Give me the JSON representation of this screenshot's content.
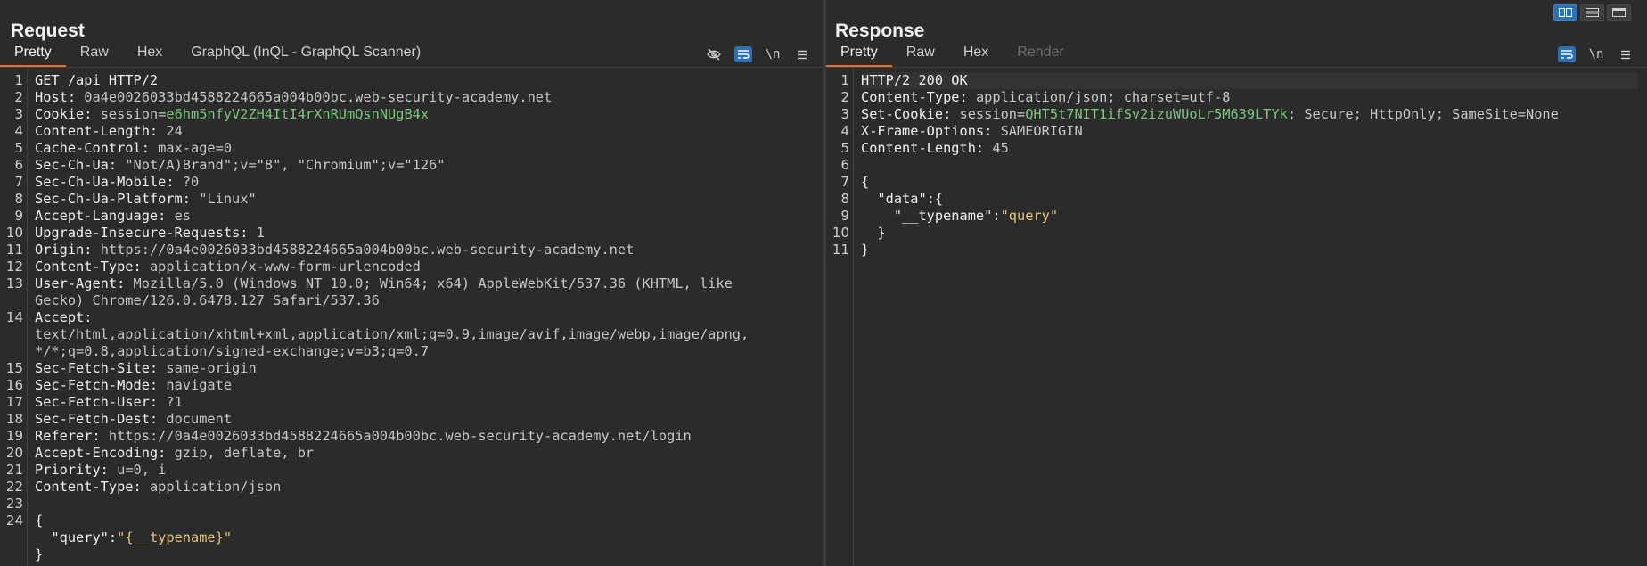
{
  "request": {
    "title": "Request",
    "tabs": [
      "Pretty",
      "Raw",
      "Hex",
      "GraphQL (InQL - GraphQL Scanner)"
    ],
    "lines": [
      {
        "n": "1",
        "parts": [
          {
            "t": "GET /api HTTP/2",
            "c": "k"
          }
        ]
      },
      {
        "n": "2",
        "parts": [
          {
            "t": "Host: ",
            "c": "k"
          },
          {
            "t": "0a4e0026033bd4588224665a004b00bc.web-security-academy.net",
            "c": "v"
          }
        ]
      },
      {
        "n": "3",
        "parts": [
          {
            "t": "Cookie: ",
            "c": "k"
          },
          {
            "t": "session",
            "c": "v"
          },
          {
            "t": "=",
            "c": "v"
          },
          {
            "t": "e6hm5nfyV2ZH4ItI4rXnRUmQsnNUgB4x",
            "c": "h"
          }
        ]
      },
      {
        "n": "4",
        "parts": [
          {
            "t": "Content-Length: ",
            "c": "k"
          },
          {
            "t": "24",
            "c": "v"
          }
        ]
      },
      {
        "n": "5",
        "parts": [
          {
            "t": "Cache-Control: ",
            "c": "k"
          },
          {
            "t": "max-age=0",
            "c": "v"
          }
        ]
      },
      {
        "n": "6",
        "parts": [
          {
            "t": "Sec-Ch-Ua: ",
            "c": "k"
          },
          {
            "t": "\"Not/A)Brand\";v=\"8\", \"Chromium\";v=\"126\"",
            "c": "v"
          }
        ]
      },
      {
        "n": "7",
        "parts": [
          {
            "t": "Sec-Ch-Ua-Mobile: ",
            "c": "k"
          },
          {
            "t": "?0",
            "c": "v"
          }
        ]
      },
      {
        "n": "8",
        "parts": [
          {
            "t": "Sec-Ch-Ua-Platform: ",
            "c": "k"
          },
          {
            "t": "\"Linux\"",
            "c": "v"
          }
        ]
      },
      {
        "n": "9",
        "parts": [
          {
            "t": "Accept-Language: ",
            "c": "k"
          },
          {
            "t": "es",
            "c": "v"
          }
        ]
      },
      {
        "n": "10",
        "parts": [
          {
            "t": "Upgrade-Insecure-Requests: ",
            "c": "k"
          },
          {
            "t": "1",
            "c": "v"
          }
        ]
      },
      {
        "n": "11",
        "parts": [
          {
            "t": "Origin: ",
            "c": "k"
          },
          {
            "t": "https://0a4e0026033bd4588224665a004b00bc.web-security-academy.net",
            "c": "v"
          }
        ]
      },
      {
        "n": "12",
        "parts": [
          {
            "t": "Content-Type: ",
            "c": "k"
          },
          {
            "t": "application/x-www-form-urlencoded",
            "c": "v"
          }
        ]
      },
      {
        "n": "13",
        "parts": [
          {
            "t": "User-Agent: ",
            "c": "k"
          },
          {
            "t": "Mozilla/5.0 (Windows NT 10.0; Win64; x64) AppleWebKit/537.36 (KHTML, like",
            "c": "v"
          }
        ]
      },
      {
        "n": "",
        "parts": [
          {
            "t": "Gecko) Chrome/126.0.6478.127 Safari/537.36",
            "c": "v"
          }
        ]
      },
      {
        "n": "14",
        "parts": [
          {
            "t": "Accept: ",
            "c": "k"
          }
        ]
      },
      {
        "n": "",
        "parts": [
          {
            "t": "text/html,application/xhtml+xml,application/xml;q=0.9,image/avif,image/webp,image/apng,",
            "c": "v"
          }
        ]
      },
      {
        "n": "",
        "parts": [
          {
            "t": "*/*;q=0.8,application/signed-exchange;v=b3;q=0.7",
            "c": "v"
          }
        ]
      },
      {
        "n": "15",
        "parts": [
          {
            "t": "Sec-Fetch-Site: ",
            "c": "k"
          },
          {
            "t": "same-origin",
            "c": "v"
          }
        ]
      },
      {
        "n": "16",
        "parts": [
          {
            "t": "Sec-Fetch-Mode: ",
            "c": "k"
          },
          {
            "t": "navigate",
            "c": "v"
          }
        ]
      },
      {
        "n": "17",
        "parts": [
          {
            "t": "Sec-Fetch-User: ",
            "c": "k"
          },
          {
            "t": "?1",
            "c": "v"
          }
        ]
      },
      {
        "n": "18",
        "parts": [
          {
            "t": "Sec-Fetch-Dest: ",
            "c": "k"
          },
          {
            "t": "document",
            "c": "v"
          }
        ]
      },
      {
        "n": "19",
        "parts": [
          {
            "t": "Referer: ",
            "c": "k"
          },
          {
            "t": "https://0a4e0026033bd4588224665a004b00bc.web-security-academy.net/login",
            "c": "v"
          }
        ]
      },
      {
        "n": "20",
        "parts": [
          {
            "t": "Accept-Encoding: ",
            "c": "k"
          },
          {
            "t": "gzip, deflate, br",
            "c": "v"
          }
        ]
      },
      {
        "n": "21",
        "parts": [
          {
            "t": "Priority: ",
            "c": "k"
          },
          {
            "t": "u=0, i",
            "c": "v"
          }
        ]
      },
      {
        "n": "22",
        "parts": [
          {
            "t": "Content-Type: ",
            "c": "k"
          },
          {
            "t": "application/json",
            "c": "v"
          }
        ]
      },
      {
        "n": "23",
        "parts": [
          {
            "t": "",
            "c": "k"
          }
        ]
      },
      {
        "n": "24",
        "parts": [
          {
            "t": "{",
            "c": "k"
          }
        ]
      },
      {
        "n": "",
        "parts": [
          {
            "t": "  \"query\"",
            "c": "k"
          },
          {
            "t": ":",
            "c": "k"
          },
          {
            "t": "\"{__typename}\"",
            "c": "s"
          }
        ]
      },
      {
        "n": "",
        "parts": [
          {
            "t": "}",
            "c": "k"
          }
        ]
      }
    ]
  },
  "response": {
    "title": "Response",
    "tabs": [
      "Pretty",
      "Raw",
      "Hex",
      "Render"
    ],
    "lines": [
      {
        "n": "1",
        "parts": [
          {
            "t": "HTTP/2 200 OK",
            "c": "k"
          }
        ]
      },
      {
        "n": "2",
        "parts": [
          {
            "t": "Content-Type: ",
            "c": "k"
          },
          {
            "t": "application/json; charset=utf-8",
            "c": "v"
          }
        ]
      },
      {
        "n": "3",
        "parts": [
          {
            "t": "Set-Cookie: ",
            "c": "k"
          },
          {
            "t": "session",
            "c": "v"
          },
          {
            "t": "=",
            "c": "v"
          },
          {
            "t": "QHT5t7NIT1ifSv2izuWUoLr5M639LTYk",
            "c": "h"
          },
          {
            "t": "; Secure; HttpOnly; SameSite=None",
            "c": "v"
          }
        ]
      },
      {
        "n": "4",
        "parts": [
          {
            "t": "X-Frame-Options: ",
            "c": "k"
          },
          {
            "t": "SAMEORIGIN",
            "c": "v"
          }
        ]
      },
      {
        "n": "5",
        "parts": [
          {
            "t": "Content-Length: ",
            "c": "k"
          },
          {
            "t": "45",
            "c": "v"
          }
        ]
      },
      {
        "n": "6",
        "parts": [
          {
            "t": "",
            "c": "k"
          }
        ]
      },
      {
        "n": "7",
        "parts": [
          {
            "t": "{",
            "c": "k"
          }
        ]
      },
      {
        "n": "8",
        "parts": [
          {
            "t": "  \"data\"",
            "c": "k"
          },
          {
            "t": ":{",
            "c": "k"
          }
        ]
      },
      {
        "n": "9",
        "parts": [
          {
            "t": "    \"__typename\"",
            "c": "k"
          },
          {
            "t": ":",
            "c": "k"
          },
          {
            "t": "\"query\"",
            "c": "s"
          }
        ]
      },
      {
        "n": "10",
        "parts": [
          {
            "t": "  }",
            "c": "k"
          }
        ]
      },
      {
        "n": "11",
        "parts": [
          {
            "t": "}",
            "c": "k"
          }
        ]
      }
    ]
  },
  "tools": {
    "newline_label": "\\n"
  }
}
